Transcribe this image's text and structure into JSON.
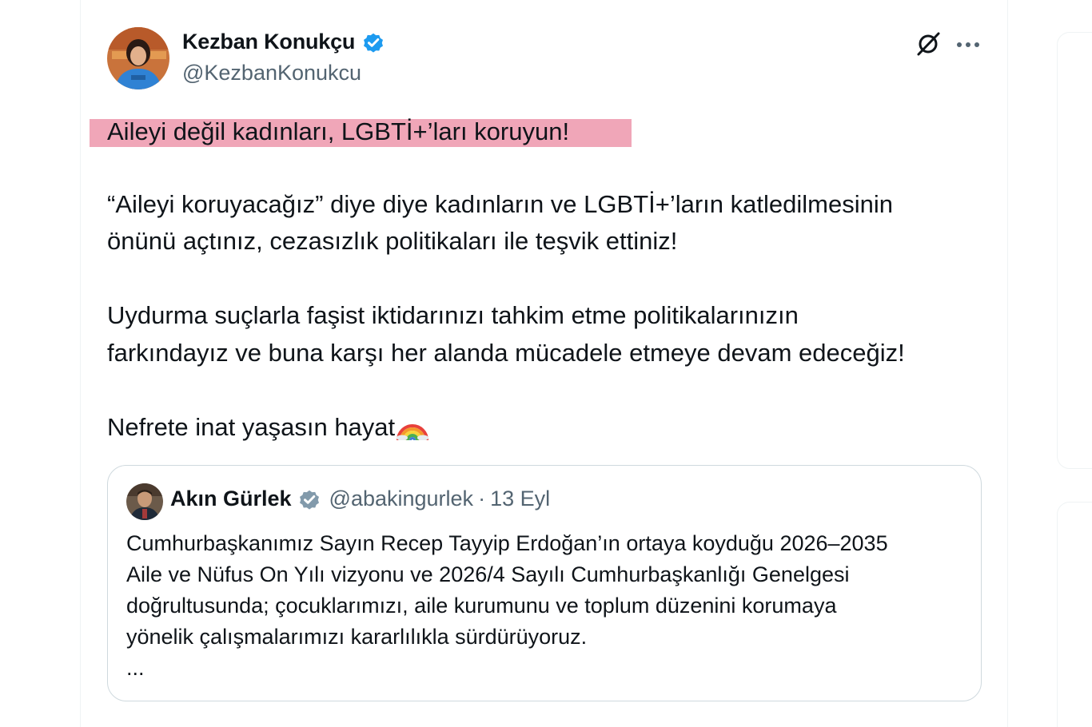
{
  "author": {
    "display_name": "Kezban Konukçu",
    "handle": "@KezbanKonukcu",
    "verified_icon": "verified-badge-icon"
  },
  "actions": {
    "grok_icon": "grok-icon",
    "more_icon": "more-options-icon"
  },
  "tweet": {
    "highlighted_line": "Aileyi değil kadınları, LGBTİ+’ları koruyun!",
    "lines": [
      "“Aileyi koruyacağız” diye diye kadınların ve LGBTİ+’ların katledilmesinin",
      "önünü açtınız, cezasızlık politikaları ile teşvik ettiniz!",
      "Uydurma suçlarla faşist iktidarınızı tahkim etme politikalarınızın",
      "farkındayız ve buna karşı her alanda mücadele etmeye devam edeceğiz!",
      "Nefrete inat yaşasın hayat"
    ],
    "emoji": "rainbow-icon"
  },
  "quoted": {
    "display_name": "Akın Gürlek",
    "handle": "@abakingurlek",
    "separator": "·",
    "date": "13 Eyl",
    "lines": [
      "Cumhurbaşkanımız Sayın Recep Tayyip Erdoğan’ın ortaya koyduğu 2026–2035",
      "Aile ve Nüfus On Yılı vizyonu ve 2026/4 Sayılı Cumhurbaşkanlığı Genelgesi",
      "doğrultusunda; çocuklarımızı, aile kurumunu ve toplum düzenini korumaya",
      "yönelik çalışmalarımızı kararlılıkla sürdürüyoruz.",
      "..."
    ]
  },
  "colors": {
    "highlight": "#f0a6b8",
    "verified_blue": "#1d9bf0",
    "verified_gray": "#829aab",
    "secondary_text": "#536471"
  }
}
